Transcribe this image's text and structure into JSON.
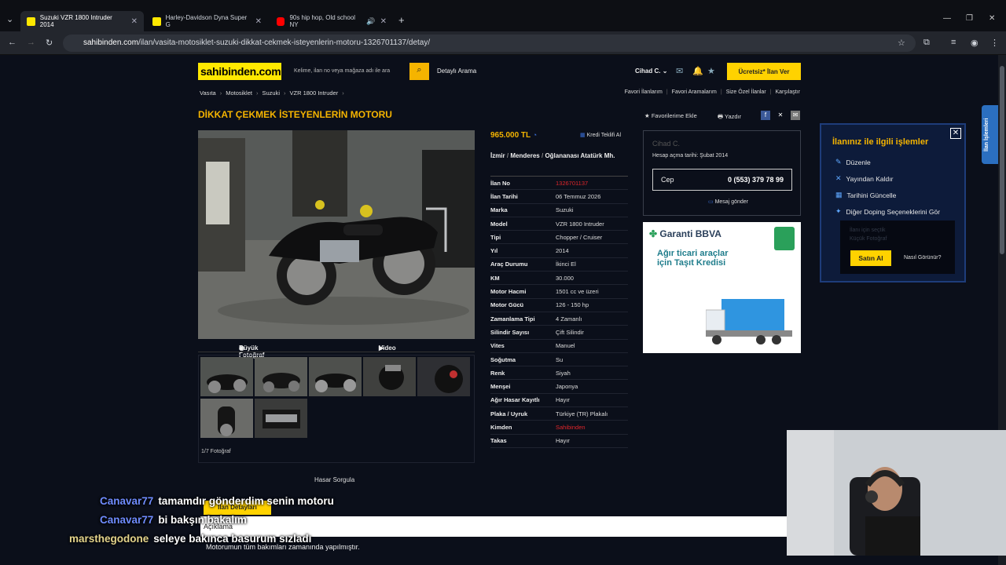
{
  "browser": {
    "tabs": [
      {
        "title": "Suzuki VZR 1800 Intruder 2014",
        "color": "#ffe800",
        "active": true
      },
      {
        "title": "Harley-Davidson Dyna Super G",
        "color": "#ffe800",
        "active": false
      },
      {
        "title": "90s hip hop, Old school NY",
        "color": "#ff0000",
        "active": false
      }
    ],
    "url_host": "sahibinden.com",
    "url_path": "/ilan/vasita-motosiklet-suzuki-dikkat-cekmek-isteyenlerin-motoru-1326701137/detay/"
  },
  "header": {
    "logo": "sahibinden.com",
    "search_placeholder": "Kelime, ilan no veya mağaza adı ile ara",
    "detailed_search": "Detaylı Arama",
    "user": "Cihad C.",
    "post_button": "Ücretsiz* İlan Ver"
  },
  "breadcrumbs": [
    "Vasıta",
    "Motosiklet",
    "Suzuki",
    "VZR 1800 Intruder"
  ],
  "top_links": [
    "Favori İlanlarım",
    "Favori Aramalarım",
    "Size Özel İlanlar",
    "Karşılaştır"
  ],
  "listing": {
    "title": "DİKKAT ÇEKMEK İSTEYENLERİN MOTORU",
    "add_favorite": "Favorilerime Ekle",
    "print": "Yazdır",
    "price": "965.000 TL",
    "loan_offer": "Kredi Teklifi Al",
    "location": [
      "İzmir",
      "Menderes",
      "Oğlananası Atatürk Mh."
    ],
    "photo_tabs": {
      "big": "Büyük Fotoğraf",
      "video": "Video"
    },
    "photo_count": "1/7 Fotoğraf",
    "details": [
      {
        "k": "İlan No",
        "v": "1326701137",
        "red": true
      },
      {
        "k": "İlan Tarihi",
        "v": "06 Temmuz 2026"
      },
      {
        "k": "Marka",
        "v": "Suzuki"
      },
      {
        "k": "Model",
        "v": "VZR 1800 Intruder"
      },
      {
        "k": "Tipi",
        "v": "Chopper / Cruiser"
      },
      {
        "k": "Yıl",
        "v": "2014"
      },
      {
        "k": "Araç Durumu",
        "v": "İkinci El"
      },
      {
        "k": "KM",
        "v": "30.000"
      },
      {
        "k": "Motor Hacmi",
        "v": "1501 cc ve üzeri"
      },
      {
        "k": "Motor Gücü",
        "v": "126 - 150 hp"
      },
      {
        "k": "Zamanlama Tipi",
        "v": "4 Zamanlı"
      },
      {
        "k": "Silindir Sayısı",
        "v": "Çift Silindir"
      },
      {
        "k": "Vites",
        "v": "Manuel"
      },
      {
        "k": "Soğutma",
        "v": "Su"
      },
      {
        "k": "Renk",
        "v": "Siyah"
      },
      {
        "k": "Menşei",
        "v": "Japonya"
      },
      {
        "k": "Ağır Hasar Kayıtlı",
        "v": "Hayır"
      },
      {
        "k": "Plaka / Uyruk",
        "v": "Türkiye (TR) Plakalı"
      },
      {
        "k": "Kimden",
        "v": "Sahibinden",
        "red": true
      },
      {
        "k": "Takas",
        "v": "Hayır"
      }
    ],
    "damage_query": "Hasar Sorgula",
    "tab_details": "İlan Detayları",
    "tab_description": "Açıklama",
    "description": "Motorumun tüm bakımları zamanında yapılmıştır."
  },
  "seller": {
    "name": "Cihad C.",
    "since": "Hesap açma tarihi: Şubat 2014",
    "phone_label": "Cep",
    "phone": "0 (553) 379 78 99",
    "message": "Mesaj gönder"
  },
  "ad": {
    "brand": "Garanti BBVA",
    "line1": "Ağır ticari araçlar",
    "line2": "için Taşıt Kredisi"
  },
  "popup": {
    "title": "İlanınız ile ilgili işlemler",
    "items": [
      "Düzenle",
      "Yayından Kaldır",
      "Tarihini Güncelle",
      "Diğer Doping Seçeneklerini Gör"
    ],
    "promo": [
      "İlanı için seçtik",
      "Küçük Fotoğraf"
    ],
    "buy": "Satın Al",
    "how": "Nasıl Görünür?",
    "side_tab": "İlan İşlemleri"
  },
  "chat": [
    {
      "user": "Canavar77",
      "msg": "tamamdır gönderdim senin motoru",
      "color": "#6f8cff"
    },
    {
      "user": "Canavar77",
      "msg": "bi bakşın bakalım",
      "color": "#6f8cff"
    },
    {
      "user": "marsthegodone",
      "msg": "seleye bakınca basurum sızladı",
      "color": "#e4d48c"
    }
  ]
}
